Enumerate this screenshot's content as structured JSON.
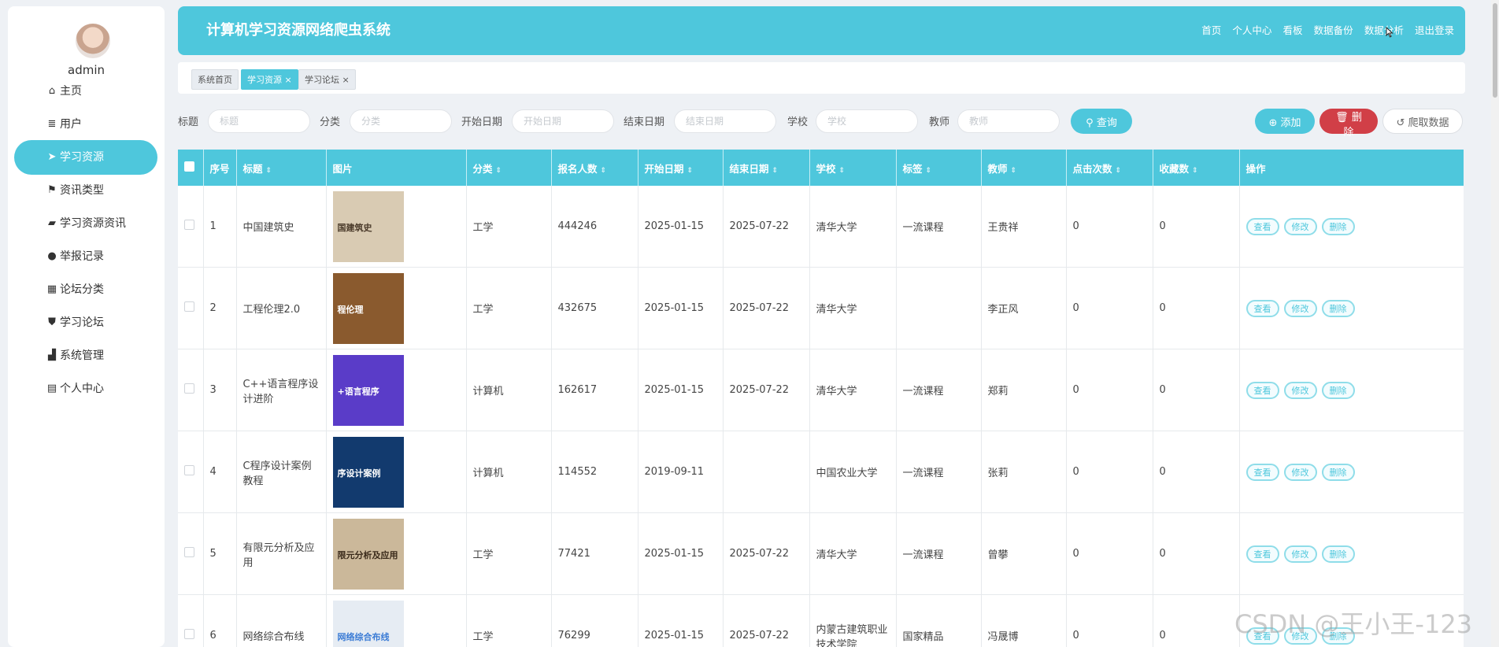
{
  "sidebar": {
    "username": "admin",
    "items": [
      {
        "label": "主页",
        "icon": "home-icon"
      },
      {
        "label": "用户",
        "icon": "list-icon"
      },
      {
        "label": "学习资源",
        "icon": "send-icon",
        "active": true
      },
      {
        "label": "资讯类型",
        "icon": "flag-icon"
      },
      {
        "label": "学习资源资讯",
        "icon": "ticket-icon"
      },
      {
        "label": "举报记录",
        "icon": "pin-icon"
      },
      {
        "label": "论坛分类",
        "icon": "grid-icon"
      },
      {
        "label": "学习论坛",
        "icon": "shield-icon"
      },
      {
        "label": "系统管理",
        "icon": "chart-icon"
      },
      {
        "label": "个人中心",
        "icon": "calendar-icon"
      }
    ]
  },
  "header": {
    "title": "计算机学习资源网络爬虫系统",
    "nav": [
      "首页",
      "个人中心",
      "看板",
      "数据备份",
      "数据分析",
      "退出登录"
    ]
  },
  "tabs": [
    {
      "label": "系统首页"
    },
    {
      "label": "学习资源 ×",
      "active": true
    },
    {
      "label": "学习论坛 ×"
    }
  ],
  "search": {
    "fields": [
      {
        "label": "标题",
        "placeholder": "标题"
      },
      {
        "label": "分类",
        "placeholder": "分类"
      },
      {
        "label": "开始日期",
        "placeholder": "开始日期"
      },
      {
        "label": "结束日期",
        "placeholder": "结束日期"
      },
      {
        "label": "学校",
        "placeholder": "学校"
      },
      {
        "label": "教师",
        "placeholder": "教师"
      }
    ],
    "search_btn": "查询"
  },
  "actions": {
    "add": "添加",
    "delete": "删除",
    "crawl": "爬取数据"
  },
  "table": {
    "headers": [
      "序号",
      "标题",
      "图片",
      "分类",
      "报名人数",
      "开始日期",
      "结束日期",
      "学校",
      "标签",
      "教师",
      "点击次数",
      "收藏数",
      "操作"
    ],
    "rows": [
      {
        "no": "1",
        "title": "中国建筑史",
        "img_text": "国建筑史",
        "img_color": "#d9cbb3",
        "img_text_color": "#4a3a2a",
        "category": "工学",
        "enrolled": "444246",
        "start": "2025-01-15",
        "end": "2025-07-22",
        "school": "清华大学",
        "tag": "一流课程",
        "teacher": "王贵祥",
        "clicks": "0",
        "favs": "0"
      },
      {
        "no": "2",
        "title": "工程伦理2.0",
        "img_text": "程伦理",
        "img_color": "#8a5a2e",
        "img_text_color": "#ffffff",
        "category": "工学",
        "enrolled": "432675",
        "start": "2025-01-15",
        "end": "2025-07-22",
        "school": "清华大学",
        "tag": "",
        "teacher": "李正风",
        "clicks": "0",
        "favs": "0"
      },
      {
        "no": "3",
        "title": "C++语言程序设计进阶",
        "img_text": "+语言程序",
        "img_color": "#5a3cc8",
        "img_text_color": "#ffffff",
        "category": "计算机",
        "enrolled": "162617",
        "start": "2025-01-15",
        "end": "2025-07-22",
        "school": "清华大学",
        "tag": "一流课程",
        "teacher": "郑莉",
        "clicks": "0",
        "favs": "0"
      },
      {
        "no": "4",
        "title": "C程序设计案例教程",
        "img_text": "序设计案例",
        "img_color": "#123a6e",
        "img_text_color": "#ffffff",
        "category": "计算机",
        "enrolled": "114552",
        "start": "2019-09-11",
        "end": "",
        "school": "中国农业大学",
        "tag": "一流课程",
        "teacher": "张莉",
        "clicks": "0",
        "favs": "0"
      },
      {
        "no": "5",
        "title": "有限元分析及应用",
        "img_text": "限元分析及应用",
        "img_color": "#cbb89a",
        "img_text_color": "#3a2a1a",
        "category": "工学",
        "enrolled": "77421",
        "start": "2025-01-15",
        "end": "2025-07-22",
        "school": "清华大学",
        "tag": "一流课程",
        "teacher": "曾攀",
        "clicks": "0",
        "favs": "0"
      },
      {
        "no": "6",
        "title": "网络综合布线",
        "img_text": "网络综合布线",
        "img_color": "#e6ecf3",
        "img_text_color": "#3a7bd5",
        "category": "工学",
        "enrolled": "76299",
        "start": "2025-01-15",
        "end": "2025-07-22",
        "school": "内蒙古建筑职业技术学院",
        "tag": "国家精品",
        "teacher": "冯晟博",
        "clicks": "0",
        "favs": "0"
      }
    ],
    "ops": [
      "查看",
      "修改",
      "删除"
    ]
  },
  "watermark": "CSDN @王小王-123"
}
